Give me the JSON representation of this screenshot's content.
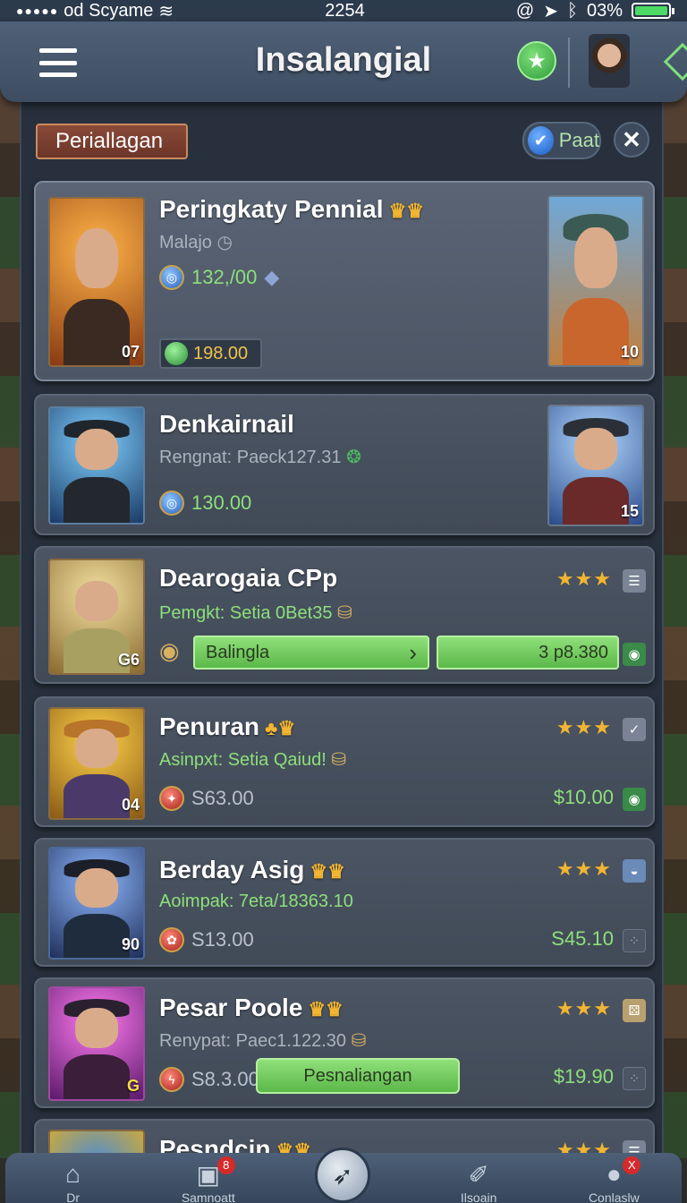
{
  "status_bar": {
    "carrier": "od Scyame",
    "time": "2254",
    "battery": "03%",
    "battery_level": 0.9
  },
  "header": {
    "title": "Insalangial",
    "menu_icon": "hamburger-menu-icon",
    "favorite_icon": "star-icon",
    "profile_icon": "avatar"
  },
  "filters": {
    "category_label": "Periallagan",
    "toggle_label": "Paat",
    "close_icon": "close-icon"
  },
  "cards": [
    {
      "title": "Peringkaty Pennial",
      "subtitle": "Malajo",
      "stat": "132,/00",
      "price": "198.00",
      "left_number": "07",
      "right_number": "10"
    },
    {
      "title": "Denkairnail",
      "subtitle": "Rengnat: Paeck127.31",
      "stat": "130.00",
      "right_number": "15"
    },
    {
      "title": "Dearogaia CPp",
      "subtitle": "Pemgkt: Setia 0Bet35",
      "left_number": "G6",
      "bar_label": "Balingla",
      "bar_value": "3 p8.380",
      "stars": "★★★"
    },
    {
      "title": "Penuran",
      "subtitle": "Asinpxt: Setia Qaiud!",
      "stat": "S63.00",
      "right_value": "$10.00",
      "left_number": "04",
      "stars": "★★★"
    },
    {
      "title": "Berday Asig",
      "subtitle": "Aoimpak: 7eta/18363.10",
      "stat": "S13.00",
      "right_value": "S45.10",
      "left_number": "90",
      "stars": "★★★"
    },
    {
      "title": "Pesar Poole",
      "subtitle": "Renypat: Paec1.122.30",
      "stat": "S8.3.00",
      "button_label": "Pesnaliangan",
      "right_value": "$19.90",
      "left_number": "G",
      "stars": "★★★"
    },
    {
      "title": "Pesndcin",
      "stars": "★★★"
    }
  ],
  "bottom_nav": [
    {
      "label": "Dr",
      "icon": "home-icon"
    },
    {
      "label": "Samnoatt",
      "icon": "cards-icon",
      "badge": "8"
    },
    {
      "label": "",
      "icon": "compass-icon"
    },
    {
      "label": "Ilsoain",
      "icon": "feather-icon"
    },
    {
      "label": "Conlaslw",
      "icon": "user-icon",
      "badge": "X"
    }
  ]
}
